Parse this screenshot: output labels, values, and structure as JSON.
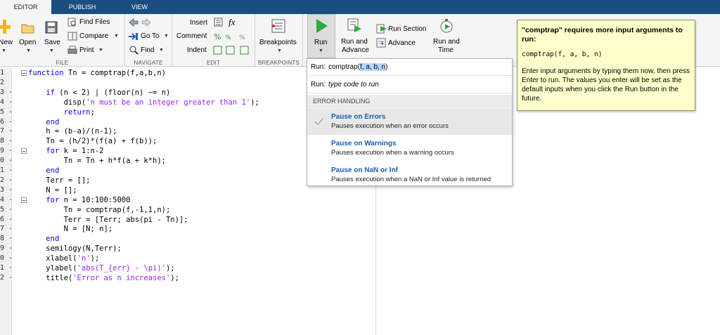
{
  "tabs": [
    "EDITOR",
    "PUBLISH",
    "VIEW"
  ],
  "file_section": {
    "new_label": "New",
    "open_label": "Open",
    "save_label": "Save",
    "find_files_label": "Find Files",
    "compare_label": "Compare",
    "print_label": "Print",
    "section_label": "FILE"
  },
  "navigate_section": {
    "goto_label": "Go To",
    "find_label": "Find",
    "section_label": "NAVIGATE"
  },
  "edit_section": {
    "insert_label": "Insert",
    "comment_label": "Comment",
    "indent_label": "Indent",
    "fx_label": "fx",
    "section_label": "EDIT"
  },
  "breakpoints_section": {
    "breakpoints_label": "Breakpoints",
    "section_label": "BREAKPOINTS"
  },
  "run_section": {
    "run_label": "Run",
    "run_and_advance_line1": "Run and",
    "run_and_advance_line2": "Advance",
    "run_section_label": "Run Section",
    "advance_label": "Advance",
    "run_and_time_line1": "Run and",
    "run_and_time_line2": "Time"
  },
  "code_lines": [
    {
      "n": "1",
      "text": "function Tn = comptrap(f,a,b,n)"
    },
    {
      "n": "2",
      "text": ""
    },
    {
      "n": "3 -",
      "text": "    if (n < 2) | (floor(n) ~= n)"
    },
    {
      "n": "4 -",
      "text": "        disp('n must be an integer greater than 1');"
    },
    {
      "n": "5 -",
      "text": "        return;"
    },
    {
      "n": "6 -",
      "text": "    end"
    },
    {
      "n": "7 -",
      "text": "    h = (b-a)/(n-1);"
    },
    {
      "n": "8 -",
      "text": "    Tn = (h/2)*(f(a) + f(b));"
    },
    {
      "n": "9 -",
      "text": "    for k = 1:n-2"
    },
    {
      "n": "0 -",
      "text": "        Tn = Tn + h*f(a + k*h);"
    },
    {
      "n": "1 -",
      "text": "    end"
    },
    {
      "n": "2 -",
      "text": "    Terr = [];"
    },
    {
      "n": "3 -",
      "text": "    N = [];"
    },
    {
      "n": "4 -",
      "text": "    for n = 10:100:5000"
    },
    {
      "n": "5 -",
      "text": "        Tn = comptrap(f,-1,1,n);"
    },
    {
      "n": "6 -",
      "text": "        Terr = [Terr; abs(pi - Tn)];"
    },
    {
      "n": "7 -",
      "text": "        N = [N; n];"
    },
    {
      "n": "8 -",
      "text": "    end"
    },
    {
      "n": "9 -",
      "text": "    semilogy(N,Terr);"
    },
    {
      "n": "0 -",
      "text": "    xlabel('n');"
    },
    {
      "n": "1 -",
      "text": "    ylabel('abs(T_{err} - \\pi)');"
    },
    {
      "n": "2 -",
      "text": "    title('Error as n increases');"
    }
  ],
  "run_dropdown": {
    "run_prefix": "Run:",
    "run_command": "comptrap(",
    "run_args": "f, a, b, n",
    "run_close": ")",
    "run_placeholder": "type code to run",
    "error_handling_header": "ERROR HANDLING",
    "items": [
      {
        "title": "Pause on Errors",
        "desc": "Pauses execution when an error occurs"
      },
      {
        "title": "Pause on Warnings",
        "desc": "Pauses execution when a warning occurs"
      },
      {
        "title": "Pause on NaN or Inf",
        "desc": "Pauses execution when a NaN or Inf value is returned"
      }
    ]
  },
  "tooltip": {
    "title": "\"comptrap\" requires more input arguments to run:",
    "signature": "comptrap(f, a, b, n)",
    "body": "Enter input arguments by typing them now, then press Enter to run. The values you enter will be set as the default inputs when you click the Run button in the future."
  },
  "colors": {
    "tab_bar": "#1a4d80",
    "keyword": "#0000ff",
    "string": "#a020f0",
    "link": "#1a5fb4",
    "tooltip_bg": "#ffffcc",
    "selection": "#b3d4fc"
  }
}
